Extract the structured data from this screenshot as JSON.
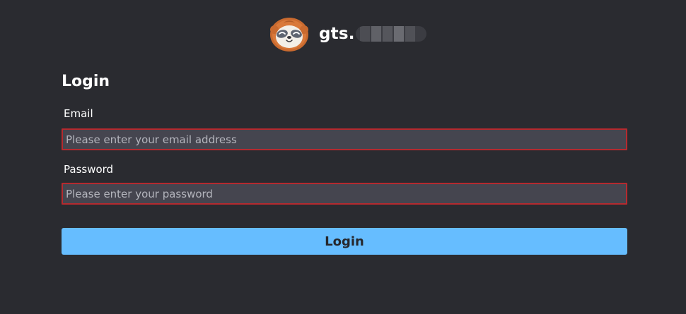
{
  "header": {
    "logo_icon": "sloth-icon",
    "site_name": "gts.",
    "site_name_redacted": true
  },
  "login_form": {
    "title": "Login",
    "email": {
      "label": "Email",
      "value": "",
      "placeholder": "Please enter your email address"
    },
    "password": {
      "label": "Password",
      "value": "",
      "placeholder": "Please enter your password"
    },
    "submit_label": "Login"
  },
  "colors": {
    "background": "#2a2b30",
    "input_background": "#45454f",
    "input_invalid_border": "#b52a2f",
    "button_accent": "#66bdff",
    "button_text": "#26272c"
  }
}
